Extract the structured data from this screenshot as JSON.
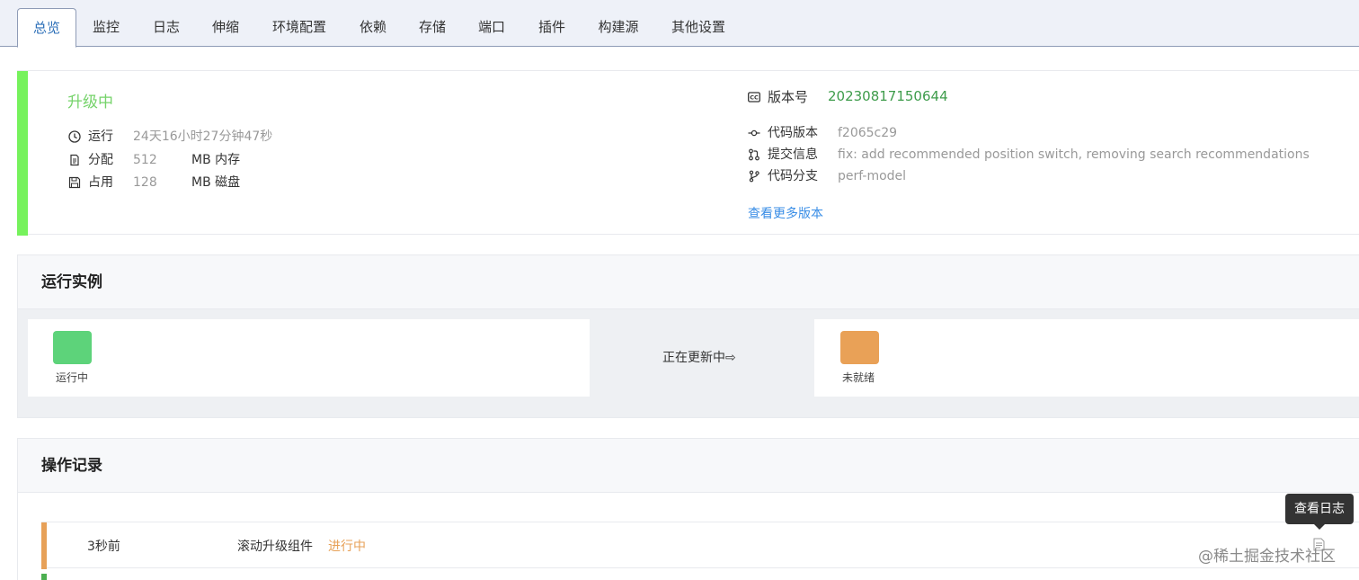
{
  "tabs": [
    {
      "label": "总览",
      "active": true
    },
    {
      "label": "监控"
    },
    {
      "label": "日志"
    },
    {
      "label": "伸缩"
    },
    {
      "label": "环境配置"
    },
    {
      "label": "依赖"
    },
    {
      "label": "存储"
    },
    {
      "label": "端口"
    },
    {
      "label": "插件"
    },
    {
      "label": "构建源"
    },
    {
      "label": "其他设置"
    }
  ],
  "status": {
    "title": "升级中",
    "running": {
      "icon": "clock-icon",
      "label": "运行",
      "value": "24天16小时27分钟47秒"
    },
    "allocated": {
      "icon": "document-icon",
      "label": "分配",
      "value": "512",
      "unit": "MB 内存"
    },
    "used": {
      "icon": "save-icon",
      "label": "占用",
      "value": "128",
      "unit": "MB 磁盘"
    },
    "version": {
      "icon": "cc-icon",
      "label": "版本号",
      "value": "20230817150644"
    },
    "code_version": {
      "icon": "commit-icon",
      "label": "代码版本",
      "value": "f2065c29"
    },
    "commit_message": {
      "icon": "pull-request-icon",
      "label": "提交信息",
      "value": "fix: add recommended position switch, removing search recommendations"
    },
    "branch": {
      "icon": "branch-icon",
      "label": "代码分支",
      "value": "perf-model"
    },
    "more_link": "查看更多版本",
    "accent_color": "#76f25c"
  },
  "instances": {
    "title": "运行实例",
    "left": {
      "label": "运行中",
      "color": "#5dd37a"
    },
    "updating_text": "正在更新中⇨",
    "right": {
      "label": "未就绪",
      "color": "#e9a157"
    }
  },
  "records": {
    "title": "操作记录",
    "items": [
      {
        "time": "3秒前",
        "action": "滚动升级组件",
        "status": "进行中",
        "color": "#e7a158"
      }
    ],
    "tooltip": "查看日志"
  },
  "watermark": "@稀土掘金技术社区"
}
